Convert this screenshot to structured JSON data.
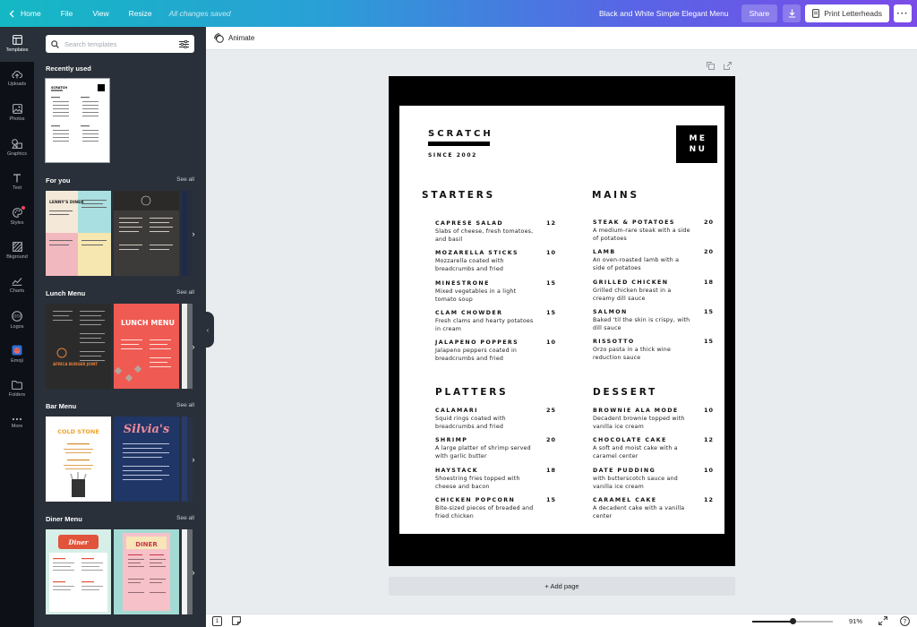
{
  "topbar": {
    "home": "Home",
    "file": "File",
    "view": "View",
    "resize": "Resize",
    "status": "All changes saved",
    "doc_title": "Black and White Simple Elegant Menu",
    "share": "Share",
    "print": "Print Letterheads"
  },
  "rail": [
    {
      "label": "Templates",
      "icon": "templates-icon"
    },
    {
      "label": "Uploads",
      "icon": "upload-icon"
    },
    {
      "label": "Photos",
      "icon": "photo-icon"
    },
    {
      "label": "Graphics",
      "icon": "graphics-icon"
    },
    {
      "label": "Text",
      "icon": "text-icon"
    },
    {
      "label": "Styles",
      "icon": "palette-icon"
    },
    {
      "label": "Bkground",
      "icon": "background-icon"
    },
    {
      "label": "Charts",
      "icon": "chart-icon"
    },
    {
      "label": "Logos",
      "icon": "logo-icon"
    },
    {
      "label": "Emoji",
      "icon": "emoji-icon"
    },
    {
      "label": "Folders",
      "icon": "folder-icon"
    },
    {
      "label": "More",
      "icon": "more-icon"
    }
  ],
  "panel": {
    "search_placeholder": "Search templates",
    "see_all": "See all",
    "sections": {
      "recent": "Recently used",
      "for_you": "For you",
      "lunch": "Lunch Menu",
      "bar": "Bar Menu",
      "diner": "Diner Menu"
    },
    "thumb_text": {
      "recent_title": "SCRATCH",
      "lennys": "LENNY'S DINER",
      "lunch_menu": "LUNCH MENU",
      "africa": "AFRICA BURGER JOINT",
      "cold_stone": "COLD STONE",
      "silvias": "Silvia's",
      "diner": "Diner",
      "diner2": "DINER"
    }
  },
  "toolbar": {
    "animate": "Animate"
  },
  "menu": {
    "brand": "SCRATCH",
    "since": "SINCE 2002",
    "logo_line1": "ME",
    "logo_line2": "NU",
    "categories": [
      {
        "title": "STARTERS",
        "items": [
          {
            "name": "CAPRESE SALAD",
            "price": "12",
            "desc": "Slabs of cheese, fresh tomatoes, and basil"
          },
          {
            "name": "MOZARELLA STICKS",
            "price": "10",
            "desc": "Mozzarella coated with breadcrumbs and fried"
          },
          {
            "name": "MINESTRONE",
            "price": "15",
            "desc": "Mixed vegetables in a light tomato soup"
          },
          {
            "name": "CLAM CHOWDER",
            "price": "15",
            "desc": "Fresh clams and hearty potatoes in cream"
          },
          {
            "name": "JALAPENO POPPERS",
            "price": "10",
            "desc": "Jalapeno peppers coated in breadcrumbs and fried"
          }
        ]
      },
      {
        "title": "MAINS",
        "items": [
          {
            "name": "STEAK & POTATOES",
            "price": "20",
            "desc": "A medium-rare steak with a side of potatoes"
          },
          {
            "name": "LAMB",
            "price": "20",
            "desc": "An oven-roasted lamb with a side of potatoes"
          },
          {
            "name": "GRILLED CHICKEN",
            "price": "18",
            "desc": "Grilled chicken breast in a creamy dill sauce"
          },
          {
            "name": "SALMON",
            "price": "15",
            "desc": "Baked 'til the skin is crispy, with dill sauce"
          },
          {
            "name": "RISSOTTO",
            "price": "15",
            "desc": "Orzo pasta in a thick wine reduction sauce"
          }
        ]
      },
      {
        "title": "PLATTERS",
        "items": [
          {
            "name": "CALAMARI",
            "price": "25",
            "desc": "Squid rings coated with breadcrumbs and fried"
          },
          {
            "name": "SHRIMP",
            "price": "20",
            "desc": "A large platter of shrimp served with garlic butter"
          },
          {
            "name": "HAYSTACK",
            "price": "18",
            "desc": "Shoestring fries topped with cheese and bacon"
          },
          {
            "name": "CHICKEN POPCORN",
            "price": "15",
            "desc": "Bite-sized pieces of breaded and fried chicken"
          }
        ]
      },
      {
        "title": "DESSERT",
        "items": [
          {
            "name": "BROWNIE ALA MODE",
            "price": "10",
            "desc": "Decadent brownie topped with vanilla ice cream"
          },
          {
            "name": "CHOCOLATE CAKE",
            "price": "12",
            "desc": "A soft and moist cake with a caramel center"
          },
          {
            "name": "DATE PUDDING",
            "price": "10",
            "desc": "with butterscotch sauce and vanilla ice cream"
          },
          {
            "name": "CARAMEL CAKE",
            "price": "12",
            "desc": "A decadent cake with a vanilla center"
          }
        ]
      }
    ]
  },
  "add_page": "+ Add page",
  "bottombar": {
    "page_number": "1",
    "zoom": "91%",
    "zoom_level": 0.5
  }
}
